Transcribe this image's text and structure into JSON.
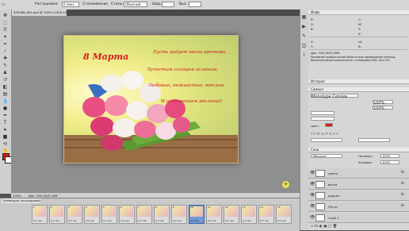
{
  "options_bar": {
    "label_size": "Растушевка:",
    "size_value": "0 пикс.",
    "antialias": "Сглаживание",
    "style_label": "Стиль:",
    "style_value": "Обычный",
    "width_label": "Шир.:",
    "height_label": "Выс.:"
  },
  "document": {
    "tab_title": "200388_8b2.psd @ 100% (1000-100, RGB/8)",
    "zoom": "100%",
    "doc_size": "Док: 900,0K/5,19M"
  },
  "card": {
    "title": "8 Марта",
    "poem": [
      "Пусть радует весна цветами,",
      "Лучистым солнцем за окном,",
      "Любовью, нежностью, теплом",
      "И исполнением желаний!"
    ]
  },
  "animation": {
    "tab": "Анимация (покадровая)",
    "frame_time": "0,2 сек",
    "frame_count": 15,
    "selected_frame": 10
  },
  "panels": {
    "info_title": "Инфо",
    "info_doc": "Док: 900,0K/5,00M",
    "info_hint": "Рисование прямоугольной области или перемещение границы. Дополнительные возможности с клавишами Shift, Alt и Ctrl",
    "history_title": "История",
    "char_title": "Символ",
    "font_row": "Monotype Corsiva",
    "size_row": "100%",
    "layers_title": "Слои",
    "blend_mode": "Обычные",
    "opacity_label": "Непрозр.:",
    "opacity_value": "100%",
    "fill_label": "Заливка:",
    "fill_value": "100%",
    "layers": [
      {
        "name": "цветы",
        "fx": "fx"
      },
      {
        "name": "весна",
        "fx": "fx"
      },
      {
        "name": "радуют",
        "fx": "fx"
      },
      {
        "name": "Пусть",
        "fx": "fx"
      },
      {
        "name": "Слой 1",
        "fx": ""
      }
    ]
  }
}
